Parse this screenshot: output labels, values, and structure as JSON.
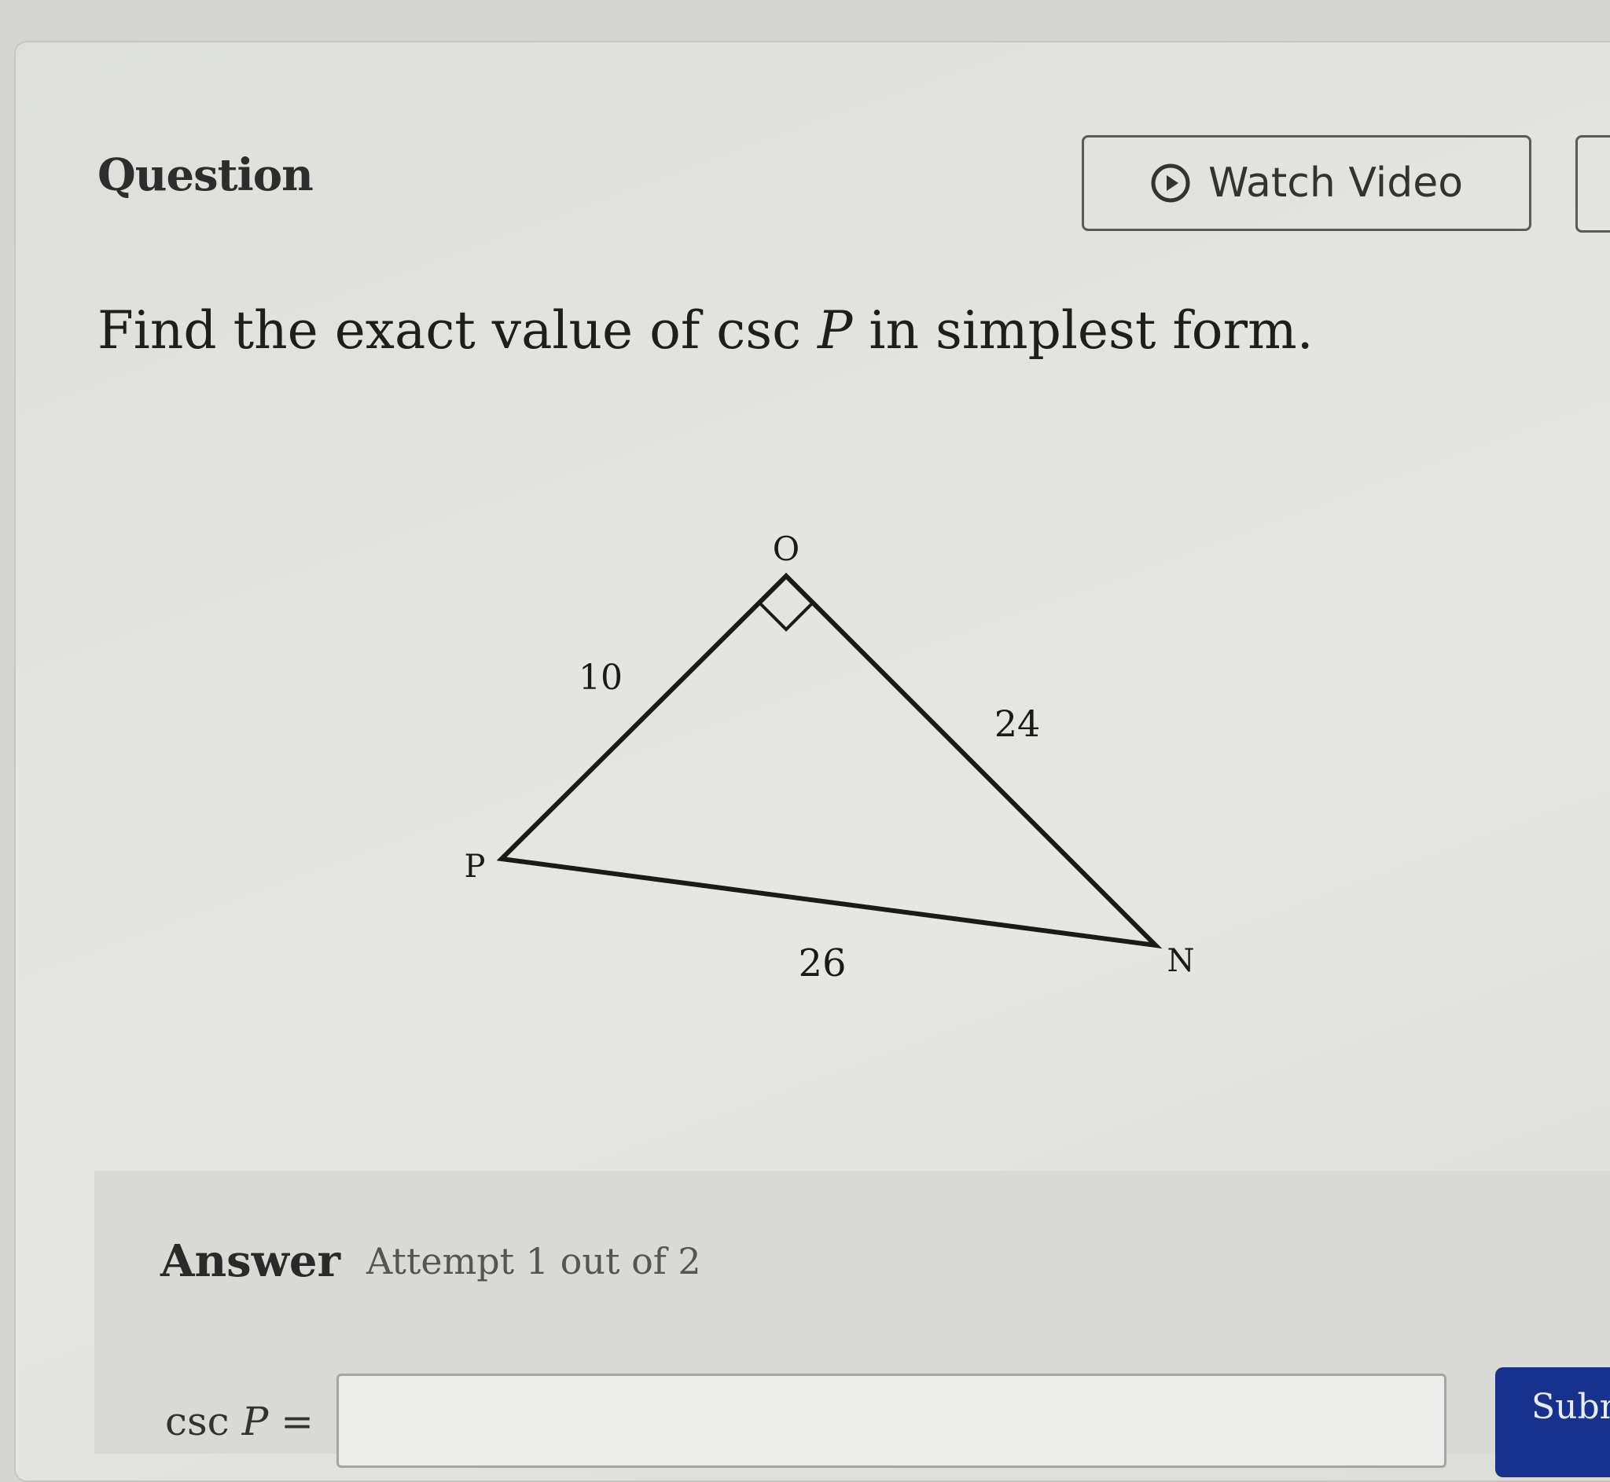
{
  "header": {
    "question_label": "Question",
    "watch_video_label": "Watch Video",
    "watch_video_icon": "play-circle-icon"
  },
  "question": {
    "prefix": "Find the exact value of csc ",
    "variable": "P",
    "suffix": " in simplest form."
  },
  "diagram": {
    "vertices": {
      "O": "O",
      "P": "P",
      "N": "N"
    },
    "sides": {
      "PO": "10",
      "ON": "24",
      "PN": "26"
    },
    "right_angle_at": "O"
  },
  "answer": {
    "label": "Answer",
    "attempt_text": "Attempt 1 out of 2",
    "eq_func": "csc ",
    "eq_var": "P",
    "eq_sign": " =",
    "input_value": "",
    "submit_label": "Submit"
  }
}
